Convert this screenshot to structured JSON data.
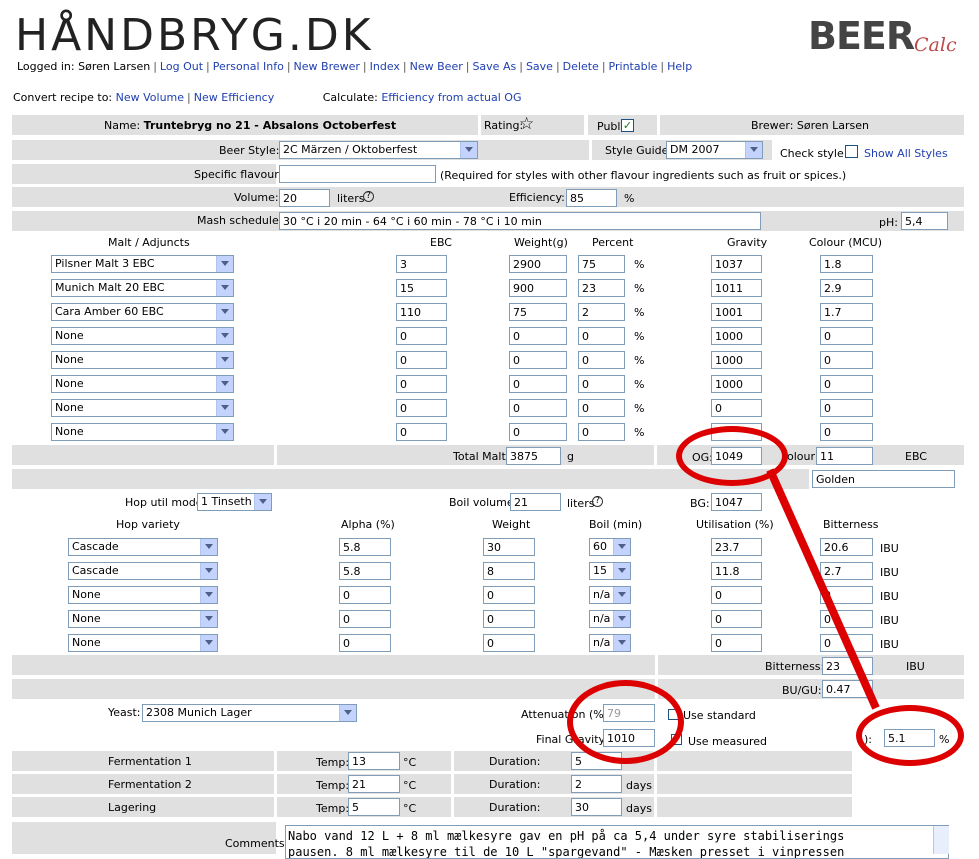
{
  "header": {
    "logo": "HÅNDBRYG.DK",
    "brand_main": "BEER",
    "brand_sub": "Calc"
  },
  "nav": {
    "logged_in": "Logged in: Søren Larsen",
    "items": [
      "Log Out",
      "Personal Info",
      "New Brewer",
      "Index",
      "New Beer",
      "Save As",
      "Save",
      "Delete",
      "Printable",
      "Help"
    ]
  },
  "convert": {
    "label": "Convert recipe to:",
    "new_volume": "New Volume",
    "new_efficiency": "New Efficiency",
    "calc_label": "Calculate:",
    "calc_link": "Efficiency from actual OG"
  },
  "recipe": {
    "name_label": "Name:",
    "name": "Truntebryg no 21 - Absalons Octoberfest",
    "rating_label": "Rating:",
    "public_label": "Public:",
    "brewer": "Brewer: Søren Larsen",
    "style_label": "Beer Style:",
    "style": "2C  Märzen / Oktoberfest",
    "guide_label": "Style Guide:",
    "guide": "DM 2007",
    "check_label": "Check style:",
    "show_all": "Show All Styles",
    "flavour_label": "Specific flavour:",
    "flavour_value": "",
    "flavour_note": "(Required for styles with other flavour ingredients such as fruit or spices.)",
    "volume_label": "Volume:",
    "volume": "20",
    "volume_unit": "liters",
    "efficiency_label": "Efficiency:",
    "efficiency": "85",
    "efficiency_unit": "%",
    "mash_label": "Mash schedule:",
    "mash": "30 °C i 20 min - 64 °C i 60 min - 78 °C i 10 min",
    "ph_label": "pH:",
    "ph": "5,4"
  },
  "malt": {
    "headers": [
      "Malt / Adjuncts",
      "EBC",
      "Weight(g)",
      "Percent",
      "Gravity",
      "Colour (MCU)"
    ],
    "rows": [
      {
        "name": "Pilsner Malt 3 EBC",
        "ebc": "3",
        "weight": "2900",
        "percent": "75",
        "gravity": "1037",
        "colour": "1.8"
      },
      {
        "name": "Munich Malt 20 EBC",
        "ebc": "15",
        "weight": "900",
        "percent": "23",
        "gravity": "1011",
        "colour": "2.9"
      },
      {
        "name": "Cara Amber 60 EBC",
        "ebc": "110",
        "weight": "75",
        "percent": "2",
        "gravity": "1001",
        "colour": "1.7"
      },
      {
        "name": "None",
        "ebc": "0",
        "weight": "0",
        "percent": "0",
        "gravity": "1000",
        "colour": "0"
      },
      {
        "name": "None",
        "ebc": "0",
        "weight": "0",
        "percent": "0",
        "gravity": "1000",
        "colour": "0"
      },
      {
        "name": "None",
        "ebc": "0",
        "weight": "0",
        "percent": "0",
        "gravity": "1000",
        "colour": "0"
      },
      {
        "name": "None",
        "ebc": "0",
        "weight": "0",
        "percent": "0",
        "gravity": "0",
        "colour": "0"
      },
      {
        "name": "None",
        "ebc": "0",
        "weight": "0",
        "percent": "0",
        "gravity": "",
        "colour": "0"
      }
    ],
    "pct": "%",
    "total_label": "Total Malt:",
    "total": "3875",
    "total_unit": "g",
    "og_label": "OG:",
    "og": "1049",
    "colour_label": "olour:",
    "colour_total": "11",
    "colour_unit": "EBC",
    "colour_name": "Golden"
  },
  "hops": {
    "util_label": "Hop util model:",
    "util": "1  Tinseth",
    "boil_label": "Boil volume:",
    "boil": "21",
    "boil_unit": "liters",
    "bg_label": "BG:",
    "bg": "1047",
    "headers": [
      "Hop variety",
      "Alpha (%)",
      "Weight",
      "Boil (min)",
      "Utilisation (%)",
      "Bitterness"
    ],
    "rows": [
      {
        "name": "Cascade",
        "alpha": "5.8",
        "weight": "30",
        "boil": "60",
        "util": "23.7",
        "bitter": "20.6"
      },
      {
        "name": "Cascade",
        "alpha": "5.8",
        "weight": "8",
        "boil": "15",
        "util": "11.8",
        "bitter": "2.7"
      },
      {
        "name": "None",
        "alpha": "0",
        "weight": "0",
        "boil": "n/a",
        "util": "0",
        "bitter": "0"
      },
      {
        "name": "None",
        "alpha": "0",
        "weight": "0",
        "boil": "n/a",
        "util": "0",
        "bitter": "0"
      },
      {
        "name": "None",
        "alpha": "0",
        "weight": "0",
        "boil": "n/a",
        "util": "0",
        "bitter": "0"
      }
    ],
    "ibu": "IBU",
    "bitterness_label": "Bitterness:",
    "bitterness": "23",
    "bugu_label": "BU/GU:",
    "bugu": "0.47"
  },
  "yeast": {
    "label": "Yeast:",
    "value": "2308 Munich Lager",
    "atten_label": "Attenuation (%):",
    "atten": "79",
    "use_standard": "Use standard",
    "fg_label": "Final Gravity:",
    "fg": "1010",
    "use_measured": "Use measured",
    "abv_label": "):",
    "abv": "5.1",
    "abv_unit": "%"
  },
  "fermentation": [
    {
      "label": "Fermentation 1",
      "temp": "13",
      "duration": "5",
      "days": ""
    },
    {
      "label": "Fermentation 2",
      "temp": "21",
      "duration": "2",
      "days": "days"
    },
    {
      "label": "Lagering",
      "temp": "5",
      "duration": "30",
      "days": "days"
    }
  ],
  "ferm_labels": {
    "temp": "Temp:",
    "deg": "°C",
    "duration": "Duration:"
  },
  "comments": {
    "label": "Comments:",
    "text": "Nabo vand 12 L + 8 ml mælkesyre gav en pH på ca 5,4 under syre stabiliserings\npausen. 8 ml mælkesyre til de 10 L \"spargevand\" - Mæsken presset i vinpressen"
  }
}
